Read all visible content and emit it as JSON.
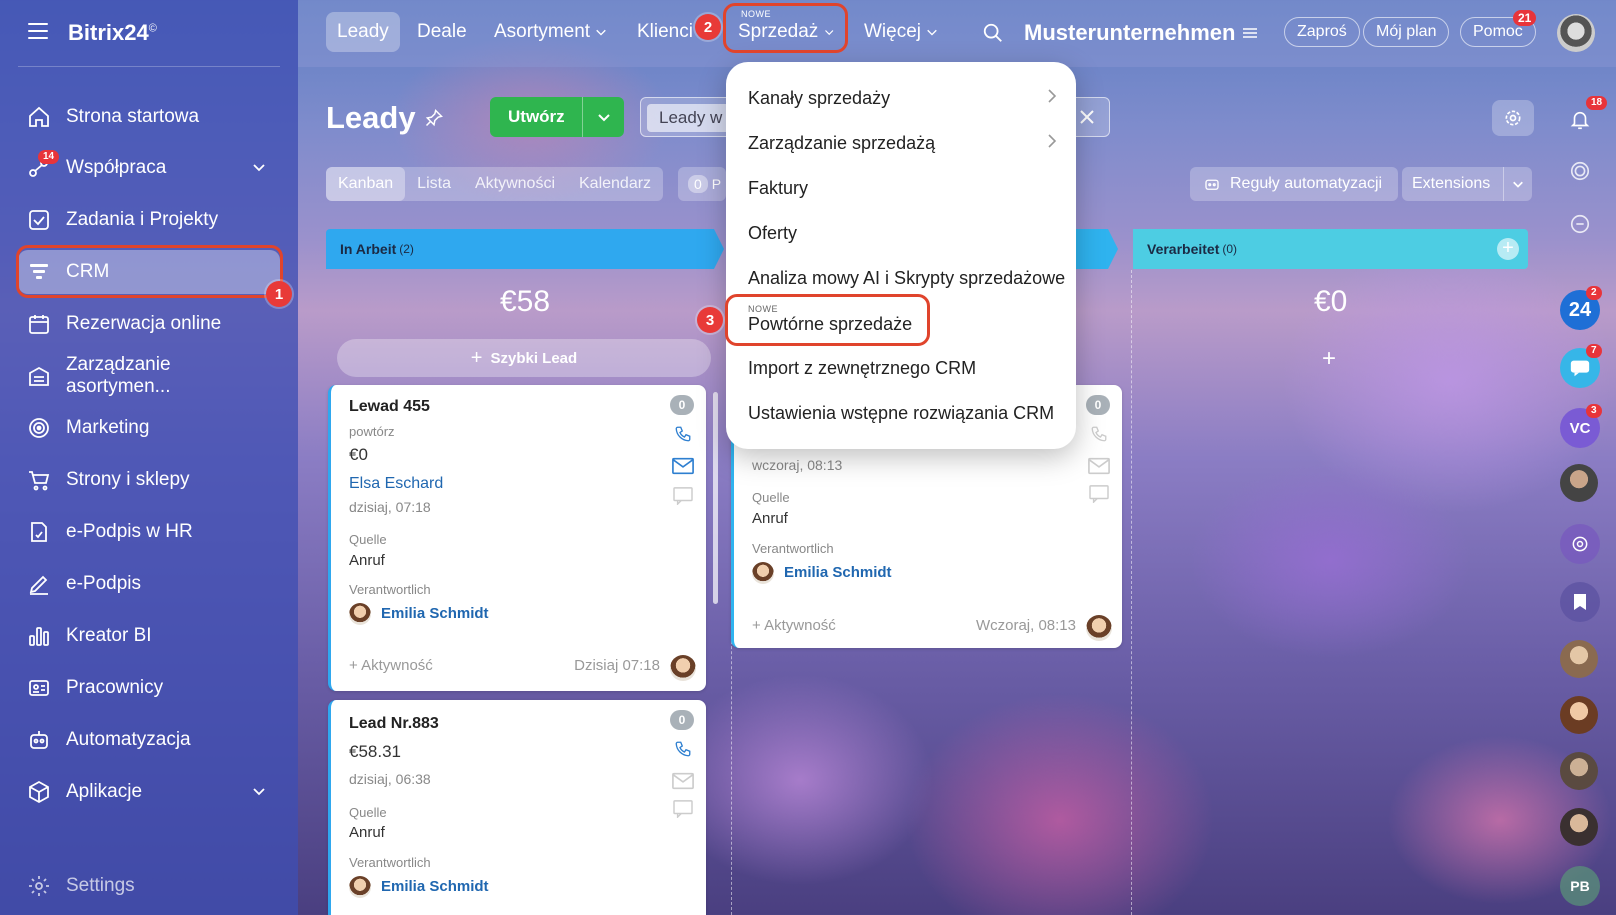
{
  "app": {
    "logo": "Bitrix24",
    "logo_mark": "©",
    "company": "Musterunternehmen"
  },
  "topnav": {
    "tabs": [
      {
        "label": "Leady"
      },
      {
        "label": "Deale"
      },
      {
        "label": "Asortyment"
      },
      {
        "label": "Klienci"
      },
      {
        "label": "Sprzedaż",
        "badge": "NOWE"
      },
      {
        "label": "Więcej"
      }
    ],
    "invite": "Zaproś",
    "plan": "Mój plan",
    "help": "Pomoc",
    "help_badge": "21"
  },
  "sidebar": {
    "items": [
      {
        "label": "Strona startowa",
        "icon": "home-icon"
      },
      {
        "label": "Współpraca",
        "icon": "collab-icon",
        "badge": "14"
      },
      {
        "label": "Zadania i Projekty",
        "icon": "tasks-icon"
      },
      {
        "label": "CRM",
        "icon": "crm-icon"
      },
      {
        "label": "Rezerwacja online",
        "icon": "calendar-icon"
      },
      {
        "label": "Zarządzanie asortymen...",
        "icon": "warehouse-icon"
      },
      {
        "label": "Marketing",
        "icon": "marketing-icon"
      },
      {
        "label": "Strony i sklepy",
        "icon": "cart-icon"
      },
      {
        "label": "e-Podpis w HR",
        "icon": "hr-sign-icon"
      },
      {
        "label": "e-Podpis",
        "icon": "pen-icon"
      },
      {
        "label": "Kreator BI",
        "icon": "chart-icon"
      },
      {
        "label": "Pracownicy",
        "icon": "employees-icon"
      },
      {
        "label": "Automatyzacja",
        "icon": "robot-icon"
      },
      {
        "label": "Aplikacje",
        "icon": "apps-icon"
      },
      {
        "label": "Settings",
        "icon": "gear-icon"
      }
    ]
  },
  "page": {
    "title": "Leady",
    "create": "Utwórz",
    "search_chip": "Leady w",
    "views": [
      "Kanban",
      "Lista",
      "Aktywności",
      "Kalendarz"
    ],
    "counter": "0",
    "counter_suffix": "P",
    "automation": "Reguły automatyzacji",
    "extensions": "Extensions",
    "notif_badge": "18"
  },
  "columns": [
    {
      "title": "In Arbeit",
      "count": "(2)",
      "sum": "€58",
      "color": "#2fa8ef"
    },
    {
      "title": "Verarbeitet",
      "count": "(0)",
      "sum": "€0",
      "color": "#4dcde3"
    }
  ],
  "quick_lead": "Szybki Lead",
  "cards": [
    {
      "title": "Lewad 455",
      "subtitle": "powtórz",
      "amount": "€0",
      "contact": "Elsa Eschard",
      "date": "dzisiaj, 07:18",
      "source_label": "Quelle",
      "source": "Anruf",
      "resp_label": "Verantwortlich",
      "resp": "Emilia Schmidt",
      "activity": "+ Aktywność",
      "time": "Dzisiaj 07:18",
      "count": "0"
    },
    {
      "title": "Lead Nr.883",
      "amount": "€58.31",
      "date": "dzisiaj, 06:38",
      "source_label": "Quelle",
      "source": "Anruf",
      "resp_label": "Verantwortlich",
      "resp": "Emilia Schmidt",
      "count": "0"
    },
    {
      "date": "wczoraj, 08:13",
      "source_label": "Quelle",
      "source": "Anruf",
      "resp_label": "Verantwortlich",
      "resp": "Emilia Schmidt",
      "activity": "+ Aktywność",
      "time": "Wczoraj, 08:13",
      "count": "0"
    }
  ],
  "dropdown": {
    "items": [
      {
        "label": "Kanały sprzedaży",
        "submenu": true
      },
      {
        "label": "Zarządzanie sprzedażą",
        "submenu": true
      },
      {
        "label": "Faktury"
      },
      {
        "label": "Oferty"
      },
      {
        "label": "Analiza mowy AI i Skrypty sprzedażowe"
      },
      {
        "label": "Powtórne sprzedaże",
        "badge": "NOWE"
      },
      {
        "label": "Import z zewnętrznego CRM"
      },
      {
        "label": "Ustawienia wstępne rozwiązania CRM"
      }
    ]
  },
  "callouts": [
    "1",
    "2",
    "3"
  ],
  "right_sidebar": {
    "b24_badge": "2",
    "chat_badge": "7",
    "vc_label": "VC",
    "vc_badge": "3",
    "pb_label": "PB"
  },
  "colors": {
    "accent_red": "#e0442c",
    "create_green": "#2fb54f",
    "link_blue": "#2067b0"
  }
}
